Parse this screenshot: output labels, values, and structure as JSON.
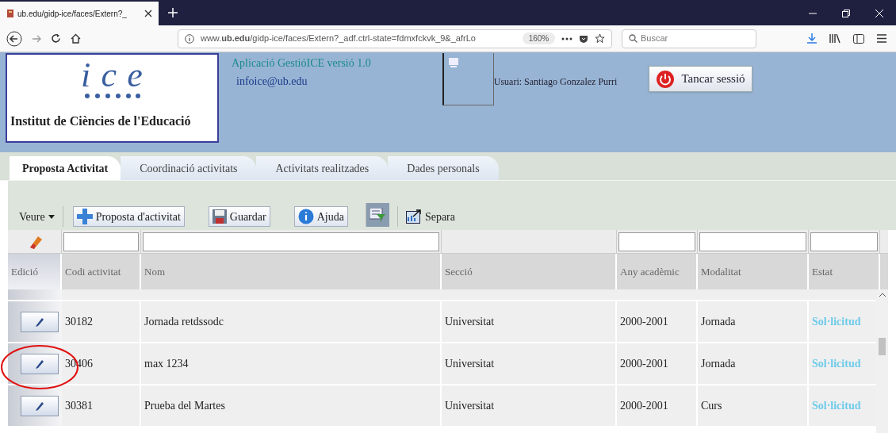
{
  "browser": {
    "tab_title": "ub.edu/gidp-ice/faces/Extern?_",
    "url": "www.**ub.edu**/gidp-ice/faces/Extern?_adf.ctrl-state=fdmxfckvk_9&_afrLo",
    "zoom": "160%",
    "search_placeholder": "Buscar"
  },
  "header": {
    "logo": "ice",
    "institute": "Institut de Ciències de l'Educació",
    "app_title": "Aplicació GestióICE versió 1.0",
    "email": "infoice@ub.edu",
    "user": "Usuari: Santiago Gonzalez Purri",
    "logout": "Tancar sessió"
  },
  "tabs": [
    {
      "label": "Proposta Activitat",
      "selected": true
    },
    {
      "label": "Coordinació activitats",
      "selected": false
    },
    {
      "label": "Activitats realitzades",
      "selected": false
    },
    {
      "label": "Dades personals",
      "selected": false
    }
  ],
  "toolbar": [
    {
      "kind": "menu",
      "label": "Veure"
    },
    {
      "kind": "add",
      "label": "Proposta d'activitat"
    },
    {
      "kind": "save",
      "label": "Guardar"
    },
    {
      "kind": "help",
      "label": "Ajuda"
    },
    {
      "kind": "filter"
    },
    {
      "kind": "detach",
      "label": "Separa"
    }
  ],
  "table": {
    "columns": [
      {
        "label": "Edició",
        "filter": false
      },
      {
        "label": "Codi activitat",
        "filter": true
      },
      {
        "label": "Nom",
        "filter": true
      },
      {
        "label": "Secció",
        "filter": false
      },
      {
        "label": "Any acadèmic",
        "filter": true
      },
      {
        "label": "Modalitat",
        "filter": true
      },
      {
        "label": "Estat",
        "filter": true
      }
    ],
    "rows": [
      {
        "code": "30182",
        "name": "Jornada retdssodc",
        "section": "Universitat",
        "year": "2000-2001",
        "mode": "Jornada",
        "status": "Sol·licitud"
      },
      {
        "code": "30406",
        "name": "max 1234",
        "section": "Universitat",
        "year": "2000-2001",
        "mode": "Jornada",
        "status": "Sol·licitud"
      },
      {
        "code": "30381",
        "name": "Prueba del Martes",
        "section": "Universitat",
        "year": "2000-2001",
        "mode": "Curs",
        "status": "Sol·licitud"
      }
    ]
  }
}
